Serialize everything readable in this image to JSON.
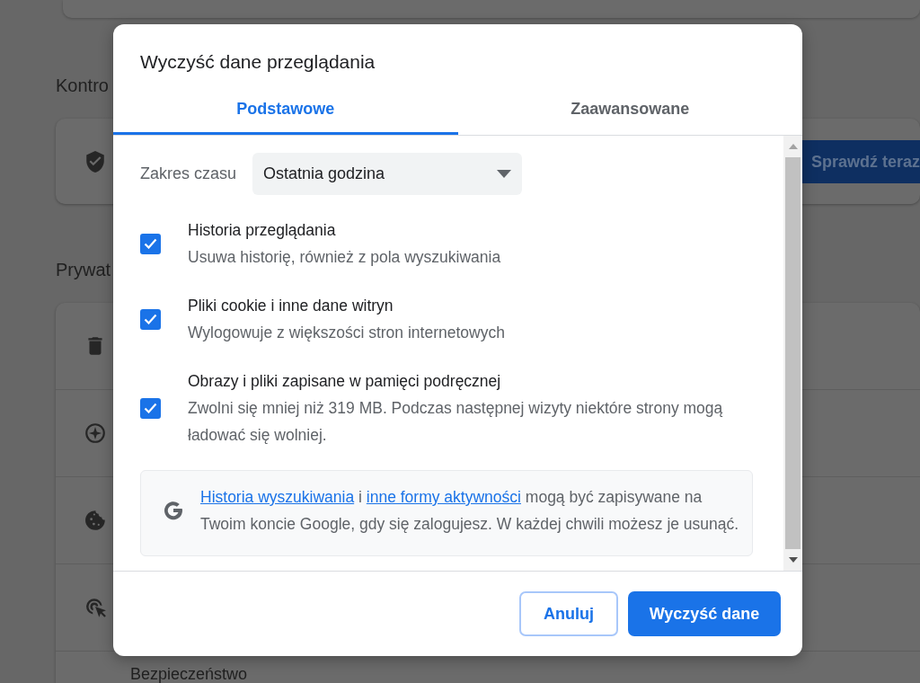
{
  "background": {
    "headings": [
      "Kontro",
      "Prywat"
    ],
    "check_button": "Sprawdź teraz",
    "row_label": "Bezpieczeństwo"
  },
  "dialog": {
    "title": "Wyczyść dane przeglądania",
    "tabs": [
      {
        "label": "Podstawowe",
        "selected": true
      },
      {
        "label": "Zaawansowane",
        "selected": false
      }
    ],
    "time_range": {
      "label": "Zakres czasu",
      "value": "Ostatnia godzina"
    },
    "options": [
      {
        "title": "Historia przeglądania",
        "description": "Usuwa historię, również z pola wyszukiwania",
        "checked": true
      },
      {
        "title": "Pliki cookie i inne dane witryn",
        "description": "Wylogowuje z większości stron internetowych",
        "checked": true
      },
      {
        "title": "Obrazy i pliki zapisane w pamięci podręcznej",
        "description": "Zwolni się mniej niż 319 MB. Podczas następnej wizyty niektóre strony mogą ładować się wolniej.",
        "checked": true
      }
    ],
    "notice": [
      {
        "kind": "link",
        "text": "Historia wyszukiwania"
      },
      {
        "kind": "text",
        "text": " i "
      },
      {
        "kind": "link",
        "text": "inne formy aktywności"
      },
      {
        "kind": "text",
        "text": " mogą być zapisywane na Twoim koncie Google, gdy się zalogujesz. W każdej chwili możesz je usunąć."
      }
    ],
    "buttons": [
      {
        "label": "Anuluj",
        "kind": "secondary"
      },
      {
        "label": "Wyczyść dane",
        "kind": "primary"
      }
    ]
  }
}
